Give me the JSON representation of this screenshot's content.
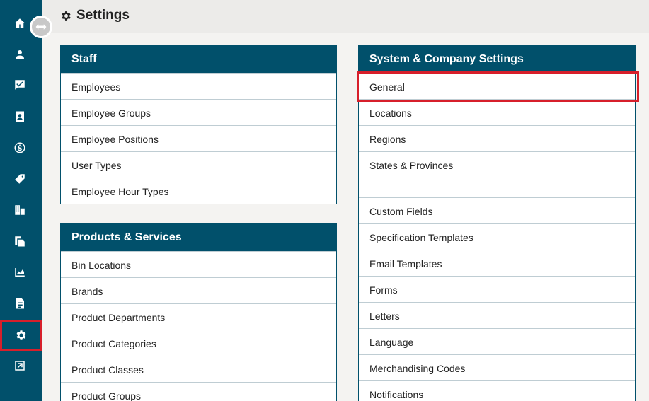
{
  "page": {
    "title": "Settings"
  },
  "sidebar": {
    "items": [
      {
        "icon": "home-icon"
      },
      {
        "icon": "customer-icon"
      },
      {
        "icon": "chat-check-icon"
      },
      {
        "icon": "contact-book-icon"
      },
      {
        "icon": "dollar-icon"
      },
      {
        "icon": "tags-icon"
      },
      {
        "icon": "buildings-icon"
      },
      {
        "icon": "documents-icon"
      },
      {
        "icon": "chart-icon"
      },
      {
        "icon": "report-icon"
      },
      {
        "icon": "gear-icon",
        "active": true
      },
      {
        "icon": "external-link-icon"
      }
    ]
  },
  "staff": {
    "title": "Staff",
    "items": [
      "Employees",
      "Employee Groups",
      "Employee Positions",
      "User Types",
      "Employee Hour Types"
    ]
  },
  "products": {
    "title": "Products & Services",
    "items": [
      "Bin Locations",
      "Brands",
      "Product Departments",
      "Product Categories",
      "Product Classes",
      "Product Groups"
    ]
  },
  "system": {
    "title": "System & Company Settings",
    "items": [
      "General",
      "Locations",
      "Regions",
      "States & Provinces",
      "",
      "Custom Fields",
      "Specification Templates",
      "Email Templates",
      "Forms",
      "Letters",
      "Language",
      "Merchandising Codes",
      "Notifications"
    ]
  },
  "colors": {
    "sidebar": "#01506b",
    "panel_header": "#01506b",
    "highlight": "#d71f2b"
  }
}
